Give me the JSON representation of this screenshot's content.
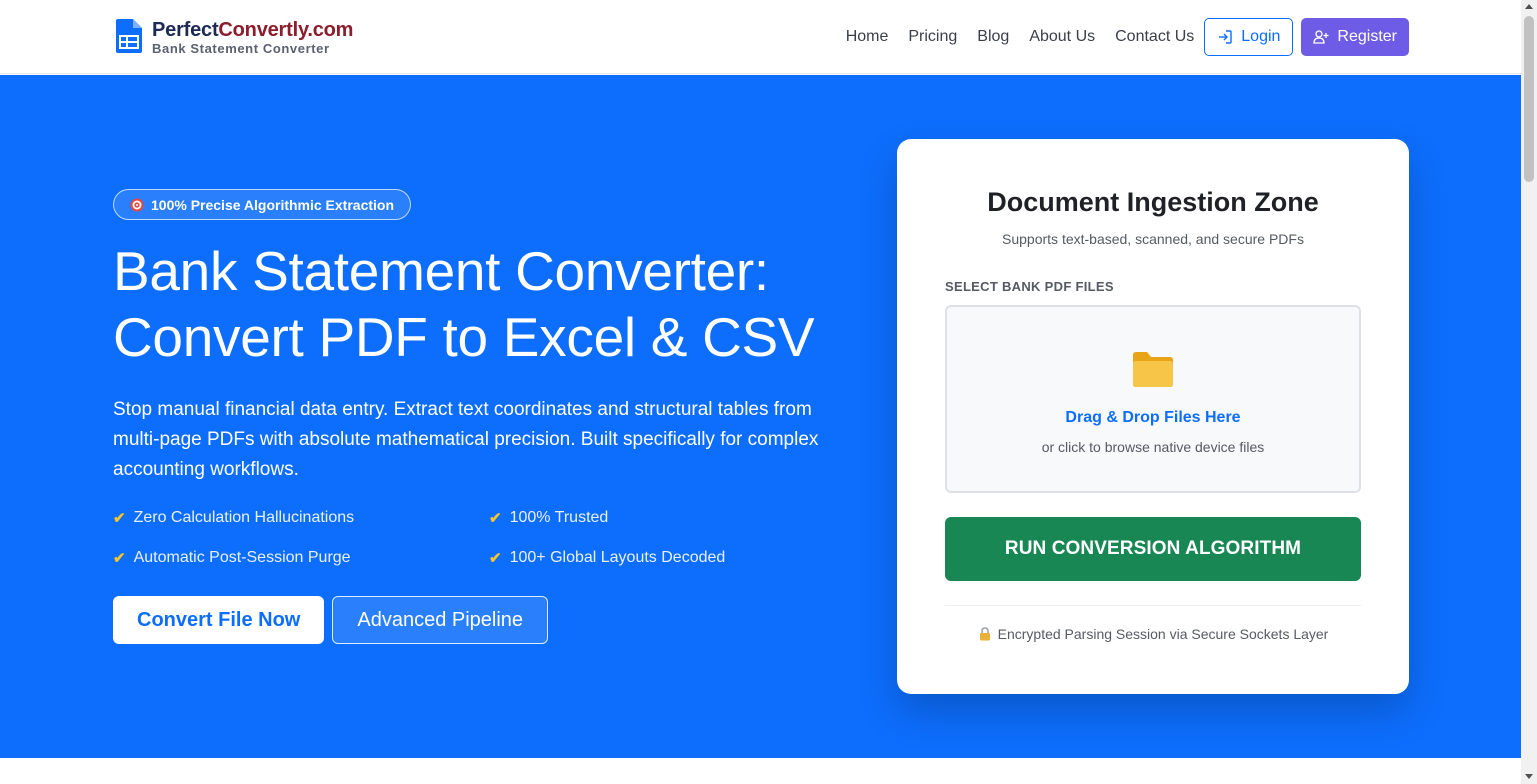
{
  "header": {
    "brand_name_part1": "Perfect",
    "brand_name_part2": "Convertly.com",
    "brand_subtitle": "Bank Statement Converter",
    "nav": [
      "Home",
      "Pricing",
      "Blog",
      "About Us",
      "Contact Us"
    ],
    "login_label": "Login",
    "register_label": "Register"
  },
  "hero": {
    "badge": "100% Precise Algorithmic Extraction",
    "title_line1": "Bank Statement Converter:",
    "title_line2": "Convert PDF to Excel & CSV",
    "description": "Stop manual financial data entry. Extract text coordinates and structural tables from multi-page PDFs with absolute mathematical precision. Built specifically for complex accounting workflows.",
    "features": [
      "Zero Calculation Hallucinations",
      "100% Trusted",
      "Automatic Post-Session Purge",
      "100+ Global Layouts Decoded"
    ],
    "primary_cta": "Convert File Now",
    "secondary_cta": "Advanced Pipeline"
  },
  "card": {
    "title": "Document Ingestion Zone",
    "subtitle": "Supports text-based, scanned, and secure PDFs",
    "field_label": "SELECT BANK PDF FILES",
    "dropzone_title": "Drag & Drop Files Here",
    "dropzone_sub": "or click to browse native device files",
    "run_button": "RUN CONVERSION ALGORITHM",
    "secure_note": "Encrypted Parsing Session via Secure Sockets Layer"
  },
  "icons": {
    "brand": "spreadsheet-file-icon",
    "login": "sign-in-icon",
    "register": "user-plus-icon",
    "badge": "target-icon",
    "feature": "checkmark-icon",
    "dropzone": "folder-icon",
    "secure": "lock-icon"
  },
  "colors": {
    "primary": "#0d6efd",
    "register": "#6f5ce6",
    "run_button": "#198754",
    "check": "#f4c430",
    "brand_dark": "#1e2a55",
    "brand_red": "#8b1d2c"
  }
}
